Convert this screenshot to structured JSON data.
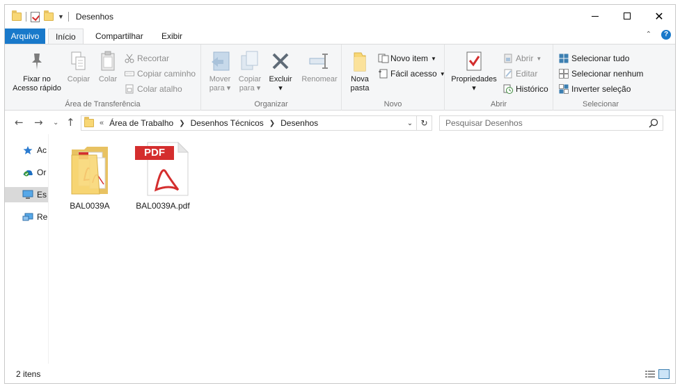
{
  "window": {
    "title": "Desenhos",
    "controls": {
      "minimize": "minimize-icon",
      "maximize": "maximize-icon",
      "close": "close-icon"
    }
  },
  "ribbon_tabs": {
    "file": "Arquivo",
    "items": [
      "Início",
      "Compartilhar",
      "Exibir"
    ],
    "active": "Início"
  },
  "ribbon": {
    "clipboard": {
      "label": "Área de Transferência",
      "pin": "Fixar no\nAcesso rápido",
      "pin_line1": "Fixar no",
      "pin_line2": "Acesso rápido",
      "copy": "Copiar",
      "paste": "Colar",
      "cut": "Recortar",
      "copy_path": "Copiar caminho",
      "paste_shortcut": "Colar atalho"
    },
    "organize": {
      "label": "Organizar",
      "move_line1": "Mover",
      "move_line2": "para",
      "copy_line1": "Copiar",
      "copy_line2": "para",
      "delete": "Excluir",
      "rename": "Renomear"
    },
    "new": {
      "label": "Novo",
      "new_folder_line1": "Nova",
      "new_folder_line2": "pasta",
      "new_item": "Novo item",
      "easy_access": "Fácil acesso"
    },
    "open": {
      "label": "Abrir",
      "properties": "Propriedades",
      "open": "Abrir",
      "edit": "Editar",
      "history": "Histórico"
    },
    "select": {
      "label": "Selecionar",
      "select_all": "Selecionar tudo",
      "select_none": "Selecionar nenhum",
      "invert": "Inverter seleção"
    }
  },
  "address": {
    "overflow": "«",
    "path": [
      "Área de Trabalho",
      "Desenhos Técnicos",
      "Desenhos"
    ]
  },
  "search": {
    "placeholder": "Pesquisar Desenhos"
  },
  "nav_pane": {
    "items": [
      {
        "label": "Ac",
        "icon": "star-icon",
        "selected": false
      },
      {
        "label": "Or",
        "icon": "onedrive-icon",
        "selected": false
      },
      {
        "label": "Es",
        "icon": "this-pc-icon",
        "selected": true
      },
      {
        "label": "Re",
        "icon": "network-icon",
        "selected": false
      }
    ]
  },
  "files": [
    {
      "name": "BAL0039A",
      "type": "folder"
    },
    {
      "name": "BAL0039A.pdf",
      "type": "pdf",
      "badge": "PDF"
    }
  ],
  "status": {
    "count": "2 itens"
  },
  "colors": {
    "accent": "#1979ca",
    "pdf_red": "#d42e2e",
    "folder": "#f8d775"
  }
}
